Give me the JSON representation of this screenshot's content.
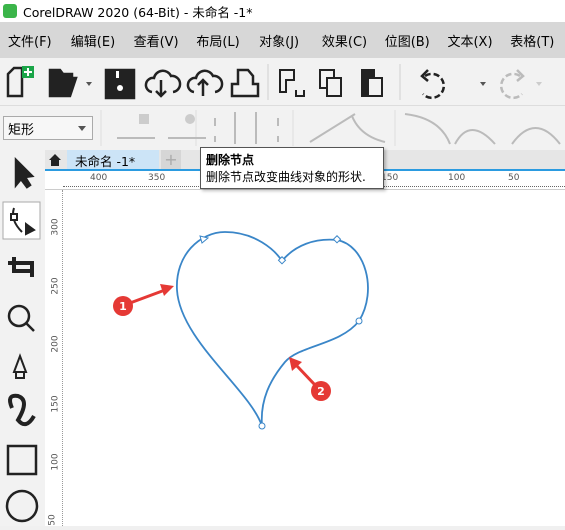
{
  "window": {
    "title": "CorelDRAW 2020 (64-Bit) - 未命名 -1*"
  },
  "menu": [
    "文件(F)",
    "编辑(E)",
    "查看(V)",
    "布局(L)",
    "对象(J)",
    "效果(C)",
    "位图(B)",
    "文本(X)",
    "表格(T)"
  ],
  "toolbar": {
    "icons": [
      "new-document-icon",
      "open-folder-icon",
      "save-icon",
      "cloud-download-icon",
      "cloud-upload-icon",
      "print-icon",
      "copy-icon",
      "paste-icon",
      "undo-icon",
      "redo-icon"
    ]
  },
  "property_bar": {
    "shape_select": "矩形"
  },
  "tabs": [
    {
      "label": "未命名 -1*",
      "active": true
    }
  ],
  "tooltip": {
    "title": "删除节点",
    "description": "删除节点改变曲线对象的形状."
  },
  "ruler": {
    "unit": "mm",
    "h_labels": [
      "400",
      "350",
      "150",
      "100",
      "50"
    ],
    "v_labels": [
      "300",
      "250",
      "200",
      "150",
      "100",
      "50"
    ]
  },
  "annotations": [
    "1",
    "2"
  ],
  "colors": {
    "curve": "#3a86c8",
    "annotation": "#e53935",
    "tab_active": "#cce4f7",
    "accent": "#2b9be0"
  }
}
